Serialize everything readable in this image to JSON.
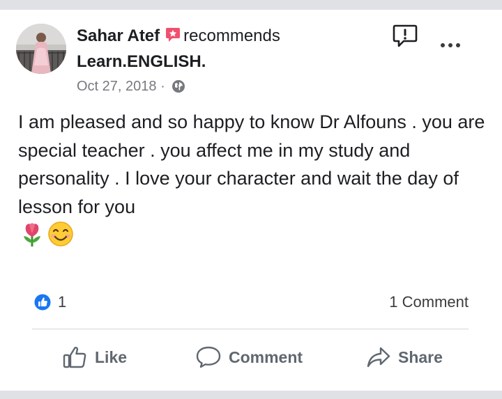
{
  "post": {
    "author": "Sahar Atef",
    "verb": "recommends",
    "page": "Learn.ENGLISH.",
    "date": "Oct 27, 2018",
    "separator": "·",
    "text": "I am pleased and so happy to know Dr Alfouns . you are special teacher . you affect me  in my study and personality . I love your character and  wait  the day of lesson for you",
    "emojis": [
      "tulip-emoji",
      "smiling-face-emoji"
    ]
  },
  "stats": {
    "reaction_count": "1",
    "comment_count": "1 Comment"
  },
  "actions": {
    "like": "Like",
    "comment": "Comment",
    "share": "Share"
  },
  "colors": {
    "recommend_badge": "#f0506e",
    "like_blue": "#1877f2",
    "text": "#1c1e21",
    "secondary": "#606770"
  }
}
